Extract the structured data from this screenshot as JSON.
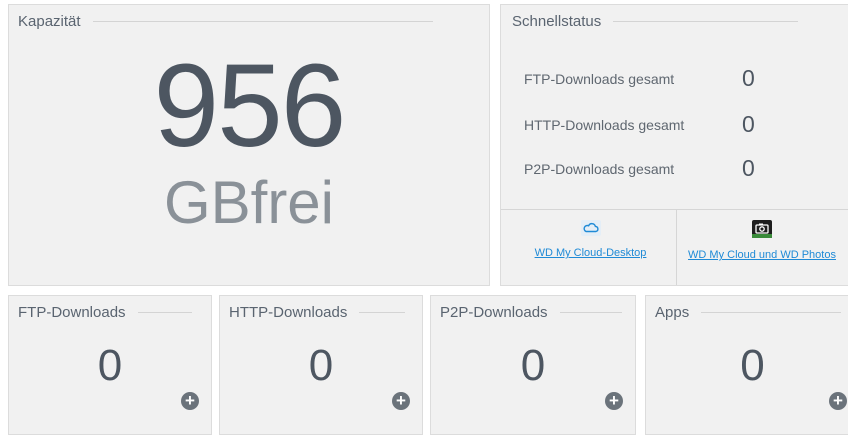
{
  "capacity": {
    "title": "Kapazität",
    "value": "956",
    "unit": "GBfrei"
  },
  "quick_status": {
    "title": "Schnellstatus",
    "rows": [
      {
        "label": "FTP-Downloads gesamt",
        "value": "0"
      },
      {
        "label": "HTTP-Downloads gesamt",
        "value": "0"
      },
      {
        "label": "P2P-Downloads gesamt",
        "value": "0"
      }
    ],
    "apps": [
      {
        "label": "WD My Cloud-Desktop",
        "icon": "cloud-icon"
      },
      {
        "label": "WD My Cloud und WD Photos",
        "icon": "camera-icon"
      }
    ]
  },
  "tiles": [
    {
      "title": "FTP-Downloads",
      "value": "0"
    },
    {
      "title": "HTTP-Downloads",
      "value": "0"
    },
    {
      "title": "P2P-Downloads",
      "value": "0"
    },
    {
      "title": "Apps",
      "value": "0"
    }
  ],
  "colors": {
    "link": "#1f8ad6",
    "panel": "#f1f1f1",
    "text": "#4d5661"
  }
}
